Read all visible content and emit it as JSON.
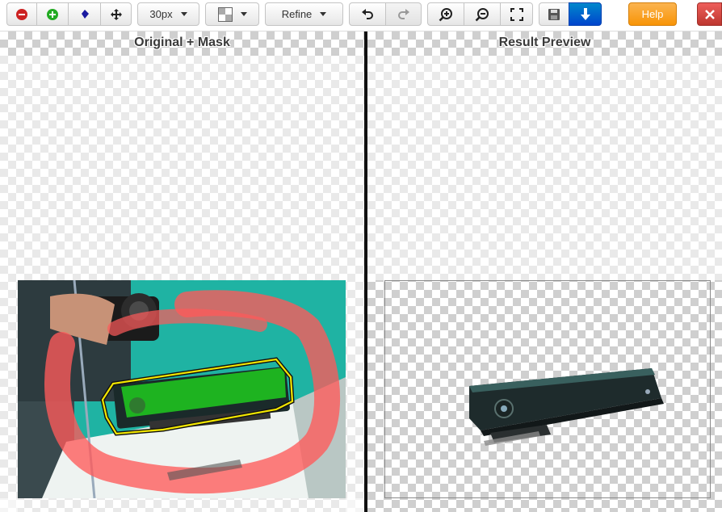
{
  "toolbar": {
    "brush_size": "30px",
    "refine_label": "Refine",
    "help_label": "Help",
    "tools": [
      {
        "name": "remove-tool",
        "icon": "minus-circle-icon"
      },
      {
        "name": "add-tool",
        "icon": "plus-circle-icon"
      },
      {
        "name": "edge-tool",
        "icon": "diamond-icon"
      },
      {
        "name": "move-tool",
        "icon": "move-arrows-icon"
      }
    ]
  },
  "panes": {
    "left_title": "Original + Mask",
    "right_title": "Result Preview"
  },
  "colors": {
    "remove": "#cc2222",
    "add": "#22aa22",
    "help": "#f89406",
    "download": "#0066cc",
    "close": "#d9534f",
    "mask_red": "#ff5a5a",
    "mask_green": "#1fc21f",
    "outline": "#f2e600"
  }
}
